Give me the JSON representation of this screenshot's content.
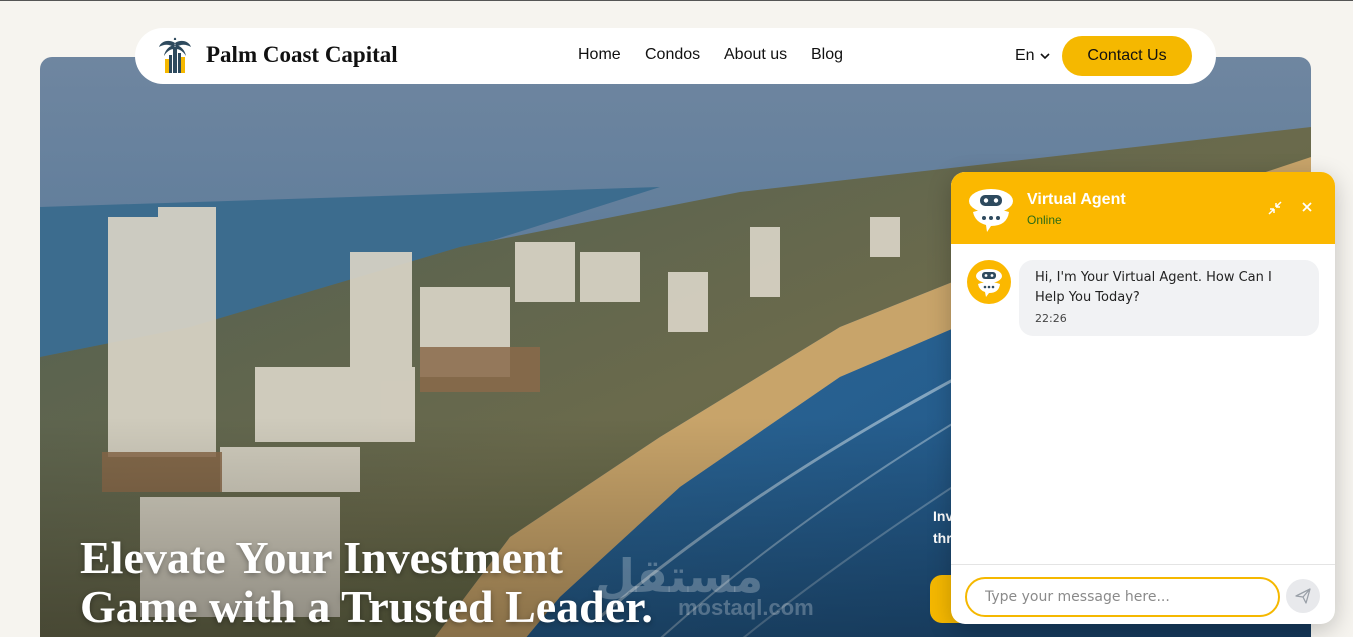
{
  "brand": {
    "name": "Palm Coast Capital",
    "logo_icon": "palm-tree-icon"
  },
  "nav": {
    "links": [
      "Home",
      "Condos",
      "About us",
      "Blog"
    ],
    "language": "En",
    "contact_label": "Contact Us"
  },
  "hero": {
    "title_line1": "Elevate Your Investment",
    "title_line2": "Game with a Trusted Leader.",
    "side_text_line1": "Inv",
    "side_text_line2": "thr",
    "watermark": "مستقل",
    "watermark_domain": "mostaql.com"
  },
  "chat": {
    "agent_name": "Virtual Agent",
    "status": "Online",
    "messages": [
      {
        "text": "Hi, I'm Your Virtual Agent. How Can I Help You Today?",
        "time": "22:26"
      }
    ],
    "input_placeholder": "Type your message here..."
  },
  "colors": {
    "accent": "#f5b800",
    "status_online": "#2b6b16",
    "page_bg": "#f6f4ef"
  }
}
